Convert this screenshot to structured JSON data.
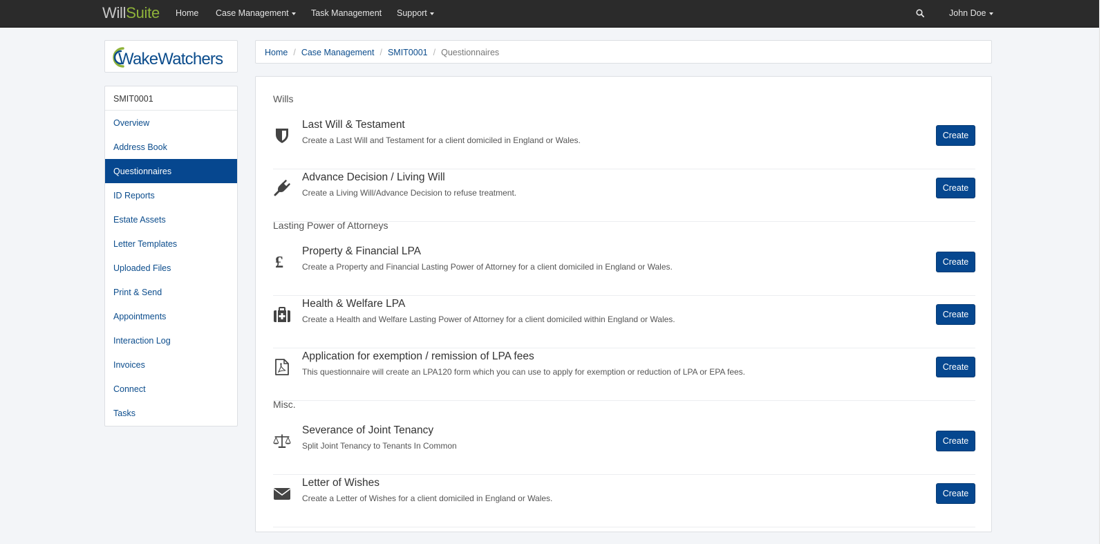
{
  "navbar": {
    "brand_part1": "Will",
    "brand_part2": "Suite",
    "items": [
      {
        "label": "Home",
        "dropdown": false
      },
      {
        "label": "Case Management",
        "dropdown": true
      },
      {
        "label": "Task Management",
        "dropdown": false
      },
      {
        "label": "Support",
        "dropdown": true
      }
    ],
    "user": "John Doe"
  },
  "logo": {
    "text": "WakeWatchers"
  },
  "sidebar": {
    "case_id": "SMIT0001",
    "items": [
      {
        "label": "Overview",
        "active": false
      },
      {
        "label": "Address Book",
        "active": false
      },
      {
        "label": "Questionnaires",
        "active": true
      },
      {
        "label": "ID Reports",
        "active": false
      },
      {
        "label": "Estate Assets",
        "active": false
      },
      {
        "label": "Letter Templates",
        "active": false
      },
      {
        "label": "Uploaded Files",
        "active": false
      },
      {
        "label": "Print & Send",
        "active": false
      },
      {
        "label": "Appointments",
        "active": false
      },
      {
        "label": "Interaction Log",
        "active": false
      },
      {
        "label": "Invoices",
        "active": false
      },
      {
        "label": "Connect",
        "active": false
      },
      {
        "label": "Tasks",
        "active": false
      }
    ]
  },
  "breadcrumb": {
    "items": [
      "Home",
      "Case Management",
      "SMIT0001"
    ],
    "current": "Questionnaires"
  },
  "main": {
    "sections": [
      {
        "heading": "Wills",
        "rows": [
          {
            "icon": "shield-icon",
            "title": "Last Will & Testament",
            "desc": "Create a Last Will and Testament for a client domiciled in England or Wales.",
            "button": "Create"
          },
          {
            "icon": "plug-icon",
            "title": "Advance Decision / Living Will",
            "desc": "Create a Living Will/Advance Decision to refuse treatment.",
            "button": "Create"
          }
        ]
      },
      {
        "heading": "Lasting Power of Attorneys",
        "rows": [
          {
            "icon": "pound-sign-icon",
            "title": "Property & Financial LPA",
            "desc": "Create a Property and Financial Lasting Power of Attorney for a client domiciled in England or Wales.",
            "button": "Create"
          },
          {
            "icon": "medkit-icon",
            "title": "Health & Welfare LPA",
            "desc": "Create a Health and Welfare Lasting Power of Attorney for a client domiciled within England or Wales.",
            "button": "Create"
          },
          {
            "icon": "pdf-file-icon",
            "title": "Application for exemption / remission of LPA fees",
            "desc": "This questionnaire will create an LPA120 form which you can use to apply for exemption or reduction of LPA or EPA fees.",
            "button": "Create"
          }
        ]
      },
      {
        "heading": "Misc.",
        "rows": [
          {
            "icon": "balance-scale-icon",
            "title": "Severance of Joint Tenancy",
            "desc": "Split Joint Tenancy to Tenants In Common",
            "button": "Create"
          },
          {
            "icon": "envelope-icon",
            "title": "Letter of Wishes",
            "desc": "Create a Letter of Wishes for a client domiciled in England or Wales.",
            "button": "Create"
          }
        ]
      }
    ]
  },
  "colors": {
    "navbar_bg": "#2b2b2b",
    "primary": "#06478f",
    "link": "#0b4c8c",
    "brand_green": "#8fb33a"
  }
}
